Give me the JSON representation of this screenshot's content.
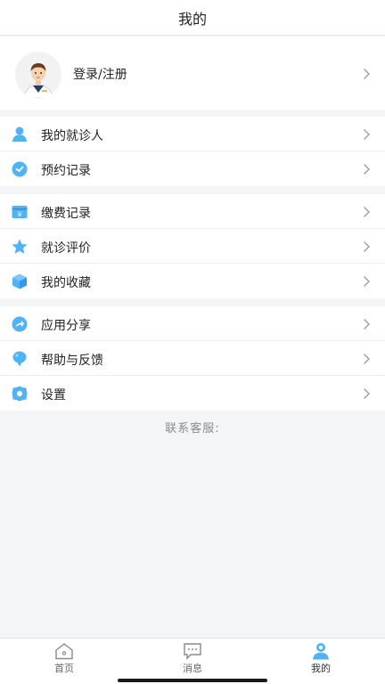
{
  "header": {
    "title": "我的"
  },
  "profile": {
    "label": "登录/注册"
  },
  "colors": {
    "accent": "#4fb3f6",
    "background": "#f4f5f7"
  },
  "groups": [
    {
      "items": [
        {
          "label": "我的就诊人",
          "icon": "patient-icon"
        },
        {
          "label": "预约记录",
          "icon": "clock-icon"
        }
      ]
    },
    {
      "items": [
        {
          "label": "缴费记录",
          "icon": "payment-icon"
        },
        {
          "label": "就诊评价",
          "icon": "star-icon"
        },
        {
          "label": "我的收藏",
          "icon": "box-icon"
        }
      ]
    },
    {
      "items": [
        {
          "label": "应用分享",
          "icon": "share-icon"
        },
        {
          "label": "帮助与反馈",
          "icon": "help-icon"
        },
        {
          "label": "设置",
          "icon": "gear-icon"
        }
      ]
    }
  ],
  "contact": {
    "label": "联系客服:"
  },
  "tabbar": {
    "tabs": [
      {
        "label": "首页",
        "icon": "home-icon"
      },
      {
        "label": "消息",
        "icon": "message-icon"
      },
      {
        "label": "我的",
        "icon": "user-icon"
      }
    ]
  }
}
